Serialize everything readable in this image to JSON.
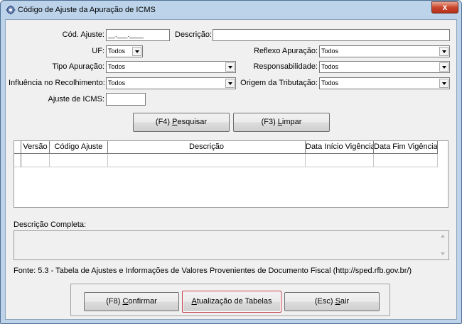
{
  "window": {
    "title": "Código de Ajuste da Apuração de ICMS",
    "close_label": "x"
  },
  "form": {
    "cod_ajuste_label": "Cód. Ajuste:",
    "cod_ajuste_value": "__.___.____",
    "descricao_label": "Descrição:",
    "descricao_value": "",
    "uf_label": "UF:",
    "uf_value": "Todos",
    "reflexo_label": "Reflexo Apuração:",
    "reflexo_value": "Todos",
    "tipo_label": "Tipo Apuração:",
    "tipo_value": "Todos",
    "responsabilidade_label": "Responsabilidade:",
    "responsabilidade_value": "Todos",
    "influencia_label": "Influência no Recolhimento:",
    "influencia_value": "Todos",
    "origem_label": "Origem da Tributação:",
    "origem_value": "Todos",
    "ajuste_icms_label": "Ajuste de ICMS:",
    "ajuste_icms_value": ""
  },
  "search_buttons": {
    "pesquisar_prefix": "(F4) ",
    "pesquisar_key": "P",
    "pesquisar_rest": "esquisar",
    "limpar_prefix": "(F3) ",
    "limpar_key": "L",
    "limpar_rest": "impar"
  },
  "table": {
    "columns": [
      "Versão",
      "Código Ajuste",
      "Descrição",
      "Data Início Vigência",
      "Data Fim Vigência"
    ]
  },
  "descricao_completa_label": "Descrição Completa:",
  "fonte_text": "Fonte: 5.3 - Tabela de Ajustes e Informações de Valores Provenientes de Documento Fiscal (http://sped.rfb.gov.br/)",
  "bottom_buttons": {
    "confirmar_prefix": "(F8) ",
    "confirmar_key": "C",
    "confirmar_rest": "onfirmar",
    "atualizacao_key": "A",
    "atualizacao_rest": "tualização de Tabelas",
    "sair_prefix": "(Esc) ",
    "sair_key": "S",
    "sair_rest": "air"
  }
}
